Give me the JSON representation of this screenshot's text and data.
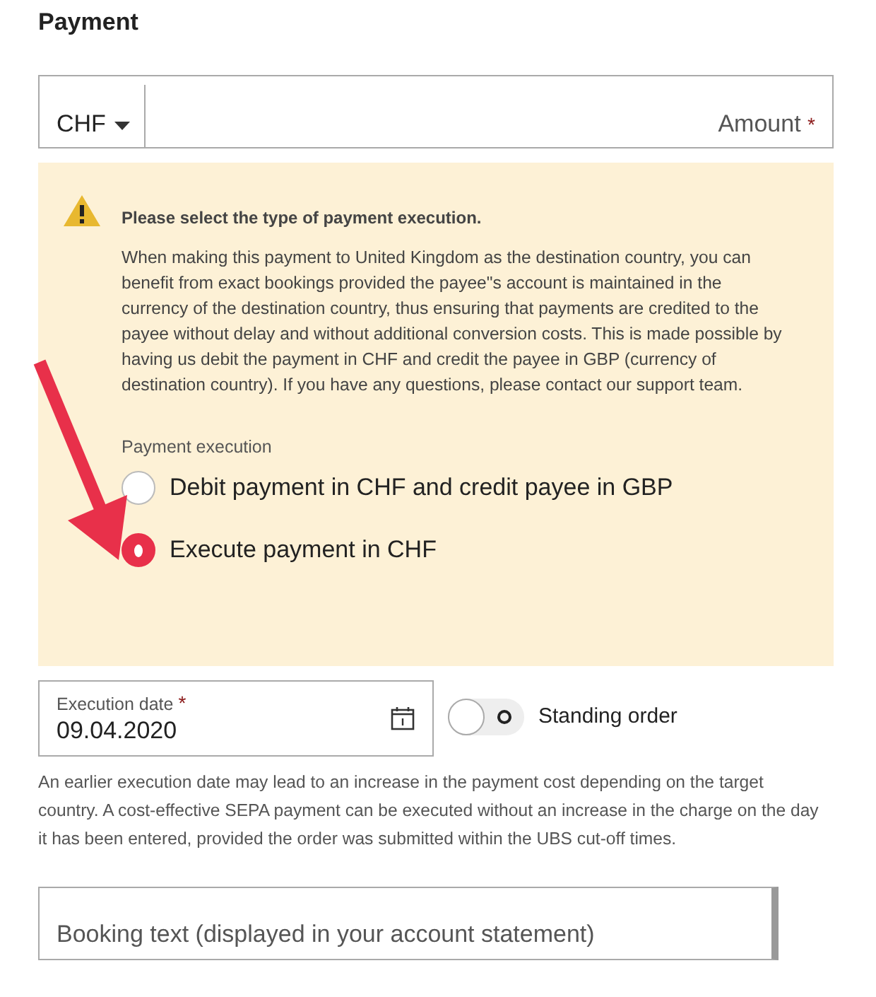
{
  "heading": "Payment",
  "amount_field": {
    "currency": "CHF",
    "placeholder": "Amount",
    "required_mark": "*"
  },
  "notice": {
    "title": "Please select the type of payment execution.",
    "text": "When making this payment to United Kingdom as the destination country, you can benefit from exact bookings provided the payee\"s account is maintained in the currency of the destination country, thus ensuring that payments are credited to the payee without delay and without additional conversion costs. This is made possible by having us debit the payment in CHF and credit the payee in GBP (currency of destination country). If you have any questions, please contact our support team.",
    "options_label": "Payment execution",
    "options": [
      {
        "label": "Debit payment in CHF and credit payee in GBP",
        "selected": false
      },
      {
        "label": "Execute payment in CHF",
        "selected": true
      }
    ]
  },
  "execution_date": {
    "label": "Execution date",
    "required_mark": "*",
    "value": "09.04.2020"
  },
  "standing_order": {
    "label": "Standing order",
    "on": false
  },
  "note": "An earlier execution date may lead to an increase in the payment cost depending on the target country. A cost-effective SEPA payment can be executed without an increase in the charge on the day it has been entered, provided the order was submitted within the UBS cut-off times.",
  "booking_field": {
    "placeholder": "Booking text (displayed in your account statement)"
  }
}
